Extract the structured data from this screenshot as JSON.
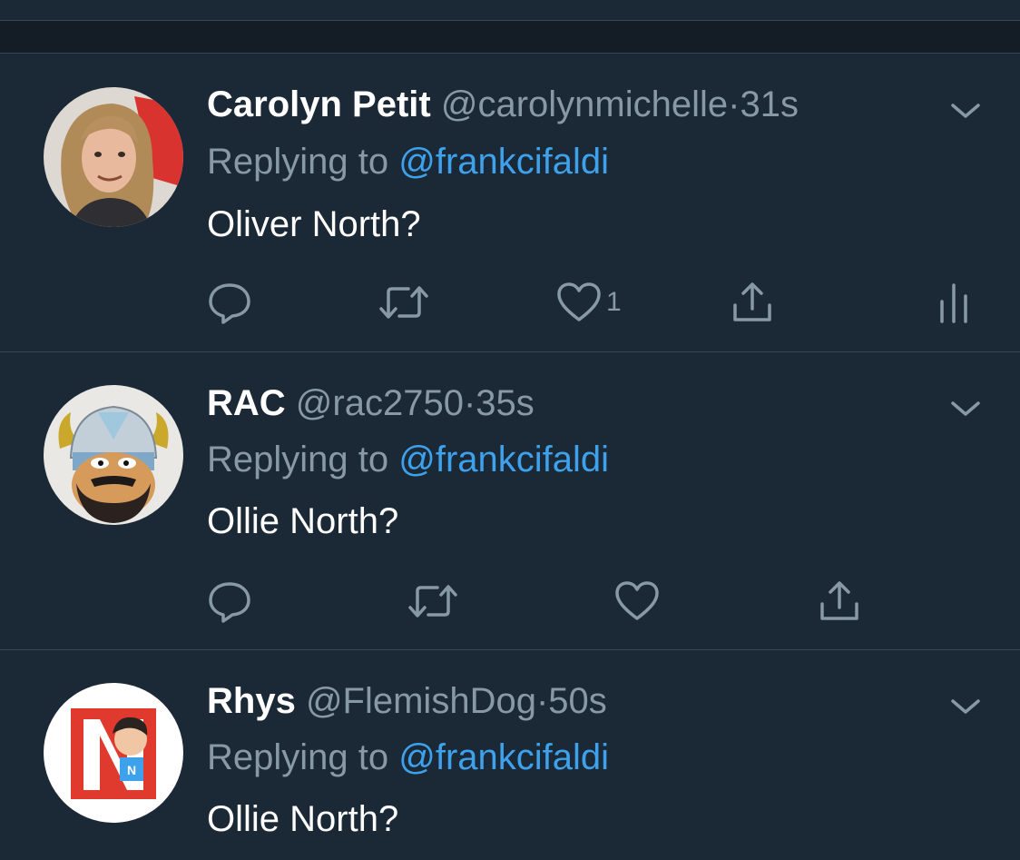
{
  "tweets": [
    {
      "name": "Carolyn Petit",
      "handle": "@carolynmichelle",
      "time": "31s",
      "reply_prefix": "Replying to",
      "reply_to": "@frankcifaldi",
      "text": "Oliver North?",
      "like_count": "1"
    },
    {
      "name": "RAC",
      "handle": "@rac2750",
      "time": "35s",
      "reply_prefix": "Replying to",
      "reply_to": "@frankcifaldi",
      "text": "Ollie North?"
    },
    {
      "name": "Rhys",
      "handle": "@FlemishDog",
      "time": "50s",
      "reply_prefix": "Replying to",
      "reply_to": "@frankcifaldi",
      "text": "Ollie North?"
    }
  ],
  "separator": "·",
  "icons": [
    "reply-icon",
    "retweet-icon",
    "like-icon",
    "share-icon",
    "analytics-icon",
    "chevron-down-icon"
  ],
  "colors": {
    "background": "#1b2836",
    "divider": "#3a4654",
    "secondary_text": "#8899a6",
    "link": "#3ea1ec",
    "primary_text": "#ffffff"
  }
}
